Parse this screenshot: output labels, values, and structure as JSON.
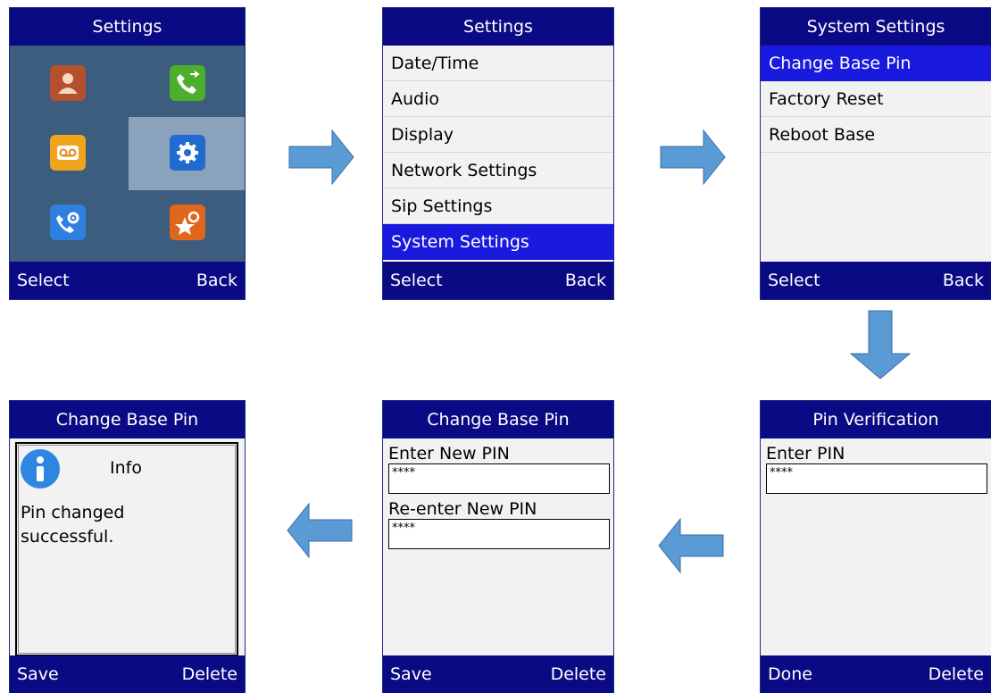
{
  "screens": {
    "home": {
      "title": "Settings",
      "soft_left": "Select",
      "soft_right": "Back",
      "icons": [
        "contacts-icon",
        "call-history-icon",
        "voicemail-icon",
        "settings-gear-icon",
        "call-settings-icon",
        "favorites-icon"
      ]
    },
    "settings": {
      "title": "Settings",
      "items": [
        "Date/Time",
        "Audio",
        "Display",
        "Network Settings",
        "Sip Settings",
        "System Settings"
      ],
      "selected": 5,
      "soft_left": "Select",
      "soft_right": "Back"
    },
    "system": {
      "title": "System Settings",
      "items": [
        "Change Base Pin",
        "Factory Reset",
        "Reboot Base"
      ],
      "selected": 0,
      "soft_left": "Select",
      "soft_right": "Back"
    },
    "verify": {
      "title": "Pin Verification",
      "label": "Enter PIN",
      "value": "****",
      "soft_left": "Done",
      "soft_right": "Delete"
    },
    "change": {
      "title": "Change Base Pin",
      "label_new": "Enter New PIN",
      "value_new": "****",
      "label_reenter": "Re-enter New PIN",
      "value_reenter": "****",
      "soft_left": "Save",
      "soft_right": "Delete"
    },
    "info": {
      "title": "Change Base Pin",
      "heading": "Info",
      "message": "Pin changed\nsuccessful.",
      "soft_left": "Save",
      "soft_right": "Delete"
    }
  },
  "colors": {
    "bar": "#0a0a85",
    "select": "#1a1adf",
    "arrow": "#5b9bd5",
    "home_bg": "#3c5d7e"
  }
}
